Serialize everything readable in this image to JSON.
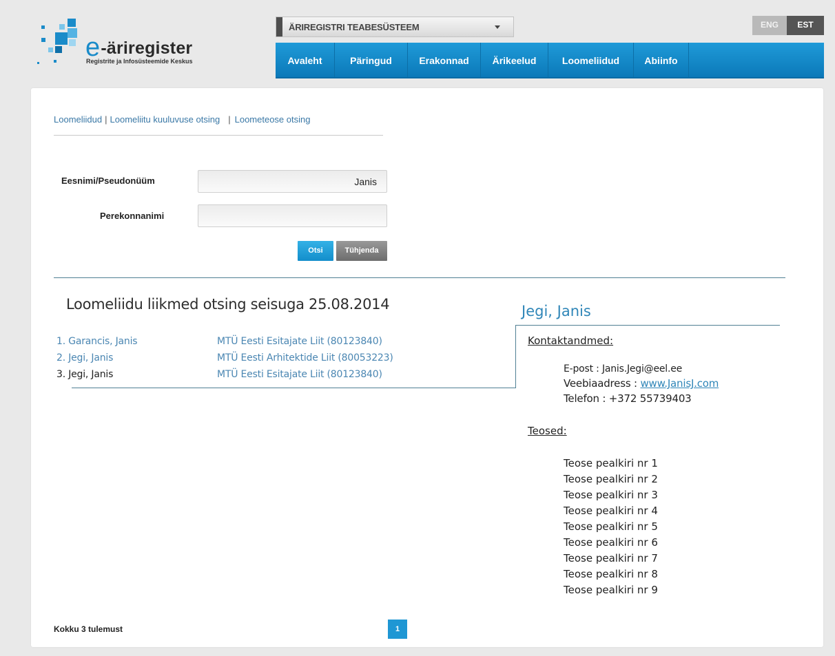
{
  "header": {
    "logo_title_letter": "e",
    "logo_title_rest": "-äriregister",
    "logo_subtitle": "Registrite ja Infosüsteemide Keskus",
    "system_select_label": "ÄRIREGISTRI TEABESÜSTEEM",
    "lang_eng": "ENG",
    "lang_est": "EST"
  },
  "nav": {
    "items": [
      "Avaleht",
      "Päringud",
      "Erakonnad",
      "Ärikeelud",
      "Loomeliidud",
      "Abiinfo"
    ]
  },
  "breadcrumb": {
    "items": [
      "Loomeliidud",
      "Loomeliitu kuuluvuse otsing",
      "Loometeose otsing"
    ],
    "separator": "|"
  },
  "form": {
    "first_name_label": "Eesnimi/Pseudonüüm",
    "first_name_value": "Janis",
    "last_name_label": "Perekonnanimi",
    "last_name_value": "",
    "search_button": "Otsi",
    "clear_button": "Tühjenda"
  },
  "results": {
    "title": "Loomeliidu liikmed otsing seisuga 25.08.2014",
    "rows": [
      {
        "name": "1. Garancis, Janis",
        "org": "MTÜ Eesti Esitajate Liit (80123840)"
      },
      {
        "name": "2. Jegi, Janis",
        "org": "MTÜ Eesti Arhitektide Liit (80053223)"
      },
      {
        "name": "3. Jegi, Janis",
        "org": "MTÜ Eesti Esitajate Liit (80123840)"
      }
    ],
    "total": "Kokku 3 tulemust",
    "page": "1"
  },
  "detail": {
    "name": "Jegi, Janis",
    "contact_heading": "Kontaktandmed:",
    "email": "E-post : Janis.Jegi@eel.ee",
    "website_label": "Veebiaadress : ",
    "website": "www.JanisJ.com",
    "phone": "Telefon : +372 55739403",
    "works_heading": "Teosed:",
    "works": [
      "Teose pealkiri nr 1",
      "Teose pealkiri nr 2",
      "Teose pealkiri nr 3",
      "Teose pealkiri nr 4",
      "Teose pealkiri nr 5",
      "Teose pealkiri nr 6",
      "Teose pealkiri nr 7",
      "Teose pealkiri nr 8",
      "Teose pealkiri nr 9"
    ]
  },
  "colors": {
    "accent": "#1f9ad8",
    "link": "#4a86b2",
    "divider": "#4f7f93"
  }
}
